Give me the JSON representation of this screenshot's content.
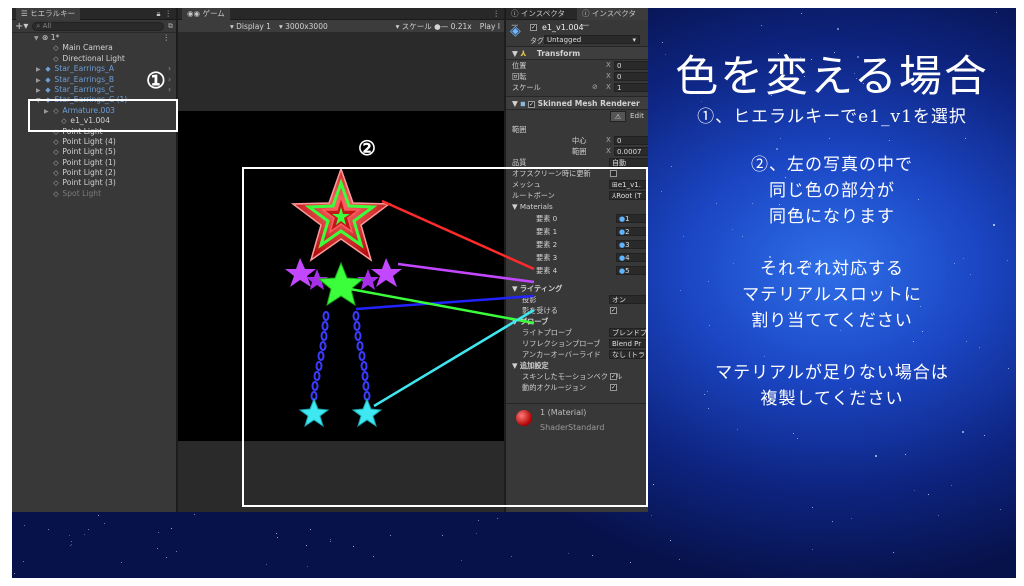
{
  "hierarchy": {
    "tab": "ヒエラルキー",
    "search_placeholder": "All",
    "scene": "1*",
    "items": [
      {
        "label": "Main Camera",
        "icon": "cube-outline-icon",
        "indent": 1,
        "style": "normal",
        "arrow": false
      },
      {
        "label": "Directional Light",
        "icon": "cube-outline-icon",
        "indent": 1,
        "style": "normal",
        "arrow": false
      },
      {
        "label": "Star_Earrings_A",
        "icon": "prefab-icon",
        "indent": 1,
        "style": "blue",
        "arrow": true
      },
      {
        "label": "Star_Earrings_B",
        "icon": "prefab-icon",
        "indent": 1,
        "style": "blue",
        "arrow": true
      },
      {
        "label": "Star_Earrings_C",
        "icon": "prefab-icon",
        "indent": 1,
        "style": "blue",
        "arrow": true
      },
      {
        "label": "Star_Earrings_C (1)",
        "icon": "prefab-icon",
        "indent": 1,
        "style": "blue",
        "arrow": true
      },
      {
        "label": "Armature.003",
        "icon": "cube-outline-icon",
        "indent": 2,
        "style": "blue",
        "arrow": true
      },
      {
        "label": "e1_v1.004",
        "icon": "cube-outline-icon",
        "indent": 2,
        "style": "normal",
        "arrow": false
      },
      {
        "label": "Point Light",
        "icon": "cube-outline-icon",
        "indent": 1,
        "style": "normal",
        "arrow": false
      },
      {
        "label": "Point Light (4)",
        "icon": "cube-outline-icon",
        "indent": 1,
        "style": "normal",
        "arrow": false
      },
      {
        "label": "Point Light (5)",
        "icon": "cube-outline-icon",
        "indent": 1,
        "style": "normal",
        "arrow": false
      },
      {
        "label": "Point Light (1)",
        "icon": "cube-outline-icon",
        "indent": 1,
        "style": "normal",
        "arrow": false
      },
      {
        "label": "Point Light (2)",
        "icon": "cube-outline-icon",
        "indent": 1,
        "style": "normal",
        "arrow": false
      },
      {
        "label": "Point Light (3)",
        "icon": "cube-outline-icon",
        "indent": 1,
        "style": "normal",
        "arrow": false
      },
      {
        "label": "Spot Light",
        "icon": "cube-outline-icon",
        "indent": 1,
        "style": "gray",
        "arrow": false
      }
    ]
  },
  "game": {
    "tab": "ゲーム",
    "display": "Display 1",
    "resolution": "3000x3000",
    "scale_label": "スケール",
    "scale_value": "0.21x",
    "play_label": "Play I"
  },
  "inspector": {
    "tab1": "インスペクター",
    "tab2": "インスペクター",
    "object_name": "e1_v1.004",
    "tag_label": "タグ",
    "tag_value": "Untagged",
    "transform": {
      "title": "Transform",
      "position_label": "位置",
      "rotation_label": "回転",
      "scale_label": "スケール",
      "x": "X",
      "pos_x": "0",
      "rot_x": "0",
      "scale_x": "1"
    },
    "renderer": {
      "title": "Skinned Mesh Renderer",
      "edit_label": "Edit",
      "bounds_label": "範囲",
      "center_label": "中心",
      "center_x": "0",
      "extent_label": "範囲",
      "extent_x": "0.0007",
      "quality_label": "品質",
      "quality_value": "自動",
      "offscreen_label": "オフスクリーン時に更新",
      "mesh_label": "メッシュ",
      "mesh_value": "e1_v1.",
      "rootbone_label": "ルートボーン",
      "rootbone_value": "Root (T",
      "materials_label": "Materials",
      "elements": [
        {
          "label": "要素 0",
          "value": "1"
        },
        {
          "label": "要素 1",
          "value": "2"
        },
        {
          "label": "要素 2",
          "value": "3"
        },
        {
          "label": "要素 3",
          "value": "4"
        },
        {
          "label": "要素 4",
          "value": "5"
        }
      ],
      "lighting_label": "ライティング",
      "cast_label": "投影",
      "cast_value": "オン",
      "receive_label": "影を受ける",
      "probe_label": "プローブ",
      "lightprobe_label": "ライトプローブ",
      "lightprobe_value": "ブレンドプロ",
      "reflprobe_label": "リフレクションプローブ",
      "reflprobe_value": "Blend Pr",
      "anchor_label": "アンカーオーバーライド",
      "anchor_value": "なし (トラン",
      "additional_label": "追加設定",
      "skinned_motion_label": "スキンしたモーションベクトル",
      "dynamic_occlusion_label": "動的オクルージョン"
    },
    "material_name": "1 (Material)",
    "shader_label": "Shader",
    "shader_value": "Standard"
  },
  "annotations": {
    "marker1": "①",
    "marker2": "②"
  },
  "slide": {
    "title": "色を変える場合",
    "step1": "①、ヒエラルキーでe1_v1を選択",
    "step2_line1": "②、左の写真の中で",
    "step2_line2": "同じ色の部分が",
    "step2_line3": "同色になります",
    "step3_line1": "それぞれ対応する",
    "step3_line2": "マテリアルスロットに",
    "step3_line3": "割り当ててください",
    "step4_line1": "マテリアルが足りない場合は",
    "step4_line2": "複製してください"
  },
  "colors": {
    "red": "#ff2b2b",
    "magenta": "#c347ff",
    "blue": "#2222ff",
    "green": "#3bff3b",
    "cyan": "#3fe8f0"
  }
}
